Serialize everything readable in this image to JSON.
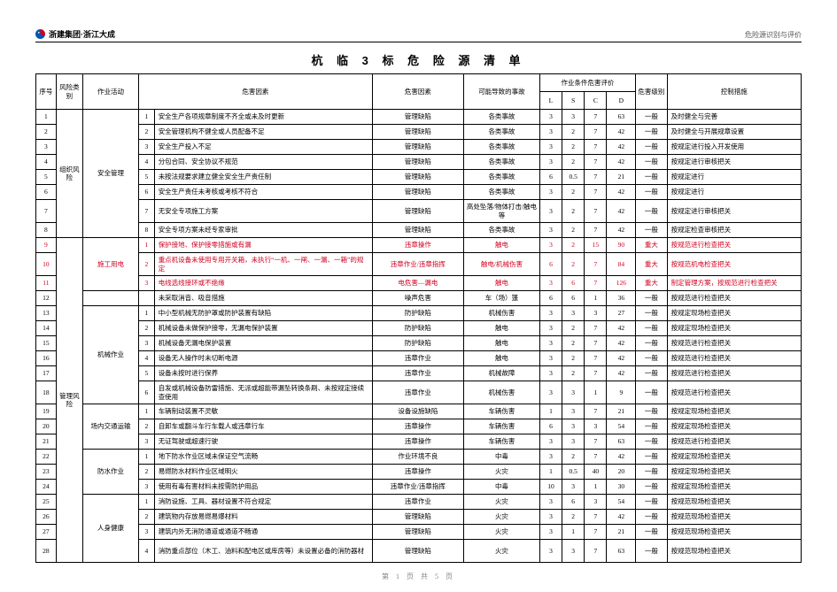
{
  "header": {
    "company": "浙建集团·浙江大成",
    "subtitle": "危险源识别与评价",
    "title": "杭 临 3 标  危 险 源 清 单"
  },
  "columns": {
    "seq": "序号",
    "cat": "风险类别",
    "act": "作业活动",
    "factor": "危害因素",
    "cause": "危害因素",
    "accident": "可能导致的事故",
    "eval": "作业条件危害评价",
    "L": "L",
    "S": "S",
    "C": "C",
    "D": "D",
    "level": "危害级别",
    "control": "控制措施"
  },
  "catGroups": [
    {
      "label": "组织风险",
      "rows": 8
    },
    {
      "label": "管理风险",
      "rows": 20
    }
  ],
  "actGroups": [
    {
      "label": "安全管理",
      "rows": 8
    },
    {
      "label": "施工用电",
      "rows": 3
    },
    {
      "label": "",
      "rows": 1
    },
    {
      "label": "机械作业",
      "rows": 6
    },
    {
      "label": "场内交通运输",
      "rows": 3
    },
    {
      "label": "防水作业",
      "rows": 3
    },
    {
      "label": "人身健康",
      "rows": 4
    }
  ],
  "rows": [
    {
      "seq": 1,
      "sub": "1",
      "factor": "安全生产各项规章制度不齐全或未及时更新",
      "cause": "管理缺陷",
      "accident": "各类事故",
      "L": 3,
      "S": 3,
      "C": 7,
      "D": 63,
      "level": "一般",
      "control": "及时健全与完善",
      "red": false
    },
    {
      "seq": 2,
      "sub": "2",
      "factor": "安全管理机构不健全或人员配备不足",
      "cause": "管理缺陷",
      "accident": "各类事故",
      "L": 3,
      "S": 2,
      "C": 7,
      "D": 42,
      "level": "一般",
      "control": "及时健全与开展规章设置",
      "red": false
    },
    {
      "seq": 3,
      "sub": "3",
      "factor": "安全生产投入不足",
      "cause": "管理缺陷",
      "accident": "各类事故",
      "L": 3,
      "S": 2,
      "C": 7,
      "D": 42,
      "level": "一般",
      "control": "按规定进行投入开发使用",
      "red": false
    },
    {
      "seq": 4,
      "sub": "4",
      "factor": "分包合同、安全协议不规范",
      "cause": "管理缺陷",
      "accident": "各类事故",
      "L": 3,
      "S": 2,
      "C": 7,
      "D": 42,
      "level": "一般",
      "control": "按规定进行审核把关",
      "red": false
    },
    {
      "seq": 5,
      "sub": "5",
      "factor": "未按法规要求建立健全安全生产责任制",
      "cause": "管理缺陷",
      "accident": "各类事故",
      "L": 6,
      "S": 0.5,
      "C": 7,
      "D": 21,
      "level": "一般",
      "control": "按规定进行",
      "red": false
    },
    {
      "seq": 6,
      "sub": "6",
      "factor": "安全生产责任未考核或考核不符合",
      "cause": "管理缺陷",
      "accident": "各类事故",
      "L": 3,
      "S": 2,
      "C": 7,
      "D": 42,
      "level": "一般",
      "control": "按规定进行",
      "red": false
    },
    {
      "seq": 7,
      "sub": "7",
      "factor": "无安全专项施工方案",
      "cause": "管理缺陷",
      "accident": "高处坠落/物体打击/触电等",
      "L": 3,
      "S": 2,
      "C": 7,
      "D": 42,
      "level": "一般",
      "control": "按规定进行审核把关",
      "red": false,
      "tall": true
    },
    {
      "seq": 8,
      "sub": "8",
      "factor": "安全专项方案未经专家审批",
      "cause": "管理缺陷",
      "accident": "各类事故",
      "L": 3,
      "S": 2,
      "C": 7,
      "D": 42,
      "level": "一般",
      "control": "按规定检查审核把关",
      "red": false
    },
    {
      "seq": 9,
      "sub": "1",
      "factor": "保护接地、保护接零措施或有漏",
      "cause": "违章操作",
      "accident": "触电",
      "L": 3,
      "S": 2,
      "C": 15,
      "D": 90,
      "level": "重大",
      "control": "按规范进行检查把关",
      "red": true
    },
    {
      "seq": 10,
      "sub": "2",
      "factor": "重点机设备未使用专用开关箱，未执行“一机、一闸、一漏、一箱”的规定",
      "cause": "违章作业/违章指挥",
      "accident": "触电/机械伤害",
      "L": 6,
      "S": 2,
      "C": 7,
      "D": 84,
      "level": "重大",
      "control": "按规范机电检查把关",
      "red": true,
      "tall": true
    },
    {
      "seq": 11,
      "sub": "3",
      "factor": "电线选线接环或不绝缘",
      "cause": "电危害—漏电",
      "accident": "触电",
      "L": 3,
      "S": 6,
      "C": 7,
      "D": 126,
      "level": "重大",
      "control": "制定管理方案，按规范进行检查把关",
      "red": true
    },
    {
      "seq": 12,
      "sub": "",
      "factor": "未采取消音、吸音措施",
      "cause": "噪声危害",
      "accident": "车（场）篷",
      "L": 6,
      "S": 6,
      "C": 1,
      "D": 36,
      "level": "一般",
      "control": "按规范进行检查把关",
      "red": false
    },
    {
      "seq": 13,
      "sub": "1",
      "factor": "中小型机械无防护罩或防护装置有缺陷",
      "cause": "防护缺陷",
      "accident": "机械伤害",
      "L": 3,
      "S": 3,
      "C": 3,
      "D": 27,
      "level": "一般",
      "control": "按规定现场检查把关",
      "red": false
    },
    {
      "seq": 14,
      "sub": "2",
      "factor": "机械设备未做保护接零，无漏电保护装置",
      "cause": "防护缺陷",
      "accident": "触电",
      "L": 3,
      "S": 2,
      "C": 7,
      "D": 42,
      "level": "一般",
      "control": "按规定现场检查把关",
      "red": false
    },
    {
      "seq": 15,
      "sub": "3",
      "factor": "机械设备无漏电保护装置",
      "cause": "防护缺陷",
      "accident": "触电",
      "L": 3,
      "S": 2,
      "C": 7,
      "D": 42,
      "level": "一般",
      "control": "按规范进行检查把关",
      "red": false
    },
    {
      "seq": 16,
      "sub": "4",
      "factor": "设备无人操作时未切断电源",
      "cause": "违章作业",
      "accident": "触电",
      "L": 3,
      "S": 2,
      "C": 7,
      "D": 42,
      "level": "一般",
      "control": "按规范进行检查把关",
      "red": false
    },
    {
      "seq": 17,
      "sub": "5",
      "factor": "设备未按时进行保养",
      "cause": "违章作业",
      "accident": "机械故障",
      "L": 3,
      "S": 2,
      "C": 7,
      "D": 42,
      "level": "一般",
      "control": "按规范进行检查把关",
      "red": false
    },
    {
      "seq": 18,
      "sub": "6",
      "factor": "自发或机械设备防雷措施、无派或超能带漏坠转换条刷、未按规定接续查使用",
      "cause": "违章作业",
      "accident": "机械伤害",
      "L": 3,
      "S": 3,
      "C": 1,
      "D": 9,
      "level": "一般",
      "control": "按规范进行检查把关",
      "red": false,
      "tall": true
    },
    {
      "seq": 19,
      "sub": "1",
      "factor": "车辆制动装置不灵敏",
      "cause": "设备设施缺陷",
      "accident": "车辆伤害",
      "L": 1,
      "S": 3,
      "C": 7,
      "D": 21,
      "level": "一般",
      "control": "按规定现场检查把关",
      "red": false
    },
    {
      "seq": 20,
      "sub": "2",
      "factor": "自卸车或翻斗车行车载人或违章行车",
      "cause": "违章操作",
      "accident": "车辆伤害",
      "L": 6,
      "S": 3,
      "C": 3,
      "D": 54,
      "level": "一般",
      "control": "按规定现场检查把关",
      "red": false
    },
    {
      "seq": 21,
      "sub": "3",
      "factor": "无证驾驶或超速行驶",
      "cause": "违章操作",
      "accident": "车辆伤害",
      "L": 3,
      "S": 3,
      "C": 7,
      "D": 63,
      "level": "一般",
      "control": "按规范进行检查把关",
      "red": false
    },
    {
      "seq": 22,
      "sub": "1",
      "factor": "地下防水作业区域未保证空气流畅",
      "cause": "作业环境不良",
      "accident": "中毒",
      "L": 3,
      "S": 2,
      "C": 7,
      "D": 42,
      "level": "一般",
      "control": "按规定现场检查把关",
      "red": false
    },
    {
      "seq": 23,
      "sub": "2",
      "factor": "易燃防水材料作业区域明火",
      "cause": "违章操作",
      "accident": "火灾",
      "L": 1,
      "S": 0.5,
      "C": 40,
      "D": 20,
      "level": "一般",
      "control": "按规定现场检查把关",
      "red": false
    },
    {
      "seq": 24,
      "sub": "3",
      "factor": "使用有毒有害材料未按需防护用品",
      "cause": "违章作业/违章指挥",
      "accident": "中毒",
      "L": 10,
      "S": 3,
      "C": 1,
      "D": 30,
      "level": "一般",
      "control": "按规定现场检查把关",
      "red": false
    },
    {
      "seq": 25,
      "sub": "1",
      "factor": "消防设施、工具、器材设置不符合规定",
      "cause": "违章作业",
      "accident": "火灾",
      "L": 3,
      "S": 6,
      "C": 3,
      "D": 54,
      "level": "一般",
      "control": "按规范现场检查把关",
      "red": false
    },
    {
      "seq": 26,
      "sub": "2",
      "factor": "建筑物内存放易燃易爆材料",
      "cause": "管理缺陷",
      "accident": "火灾",
      "L": 3,
      "S": 2,
      "C": 7,
      "D": 42,
      "level": "一般",
      "control": "按规范现场检查把关",
      "red": false
    },
    {
      "seq": 27,
      "sub": "3",
      "factor": "建筑内外无消防通道或通道不畅通",
      "cause": "管理缺陷",
      "accident": "火灾",
      "L": 3,
      "S": 1,
      "C": 7,
      "D": 21,
      "level": "一般",
      "control": "按规范现场检查把关",
      "red": false
    },
    {
      "seq": 28,
      "sub": "4",
      "factor": "消防重点部位（木工、油料和配电区或库房等）未设置必备的消防器材",
      "cause": "管理缺陷",
      "accident": "火灾",
      "L": 3,
      "S": 3,
      "C": 7,
      "D": 63,
      "level": "一般",
      "control": "按规范现场检查把关",
      "red": false,
      "tall": true
    }
  ],
  "footer": {
    "page": "第 1 页 共 5 页"
  }
}
